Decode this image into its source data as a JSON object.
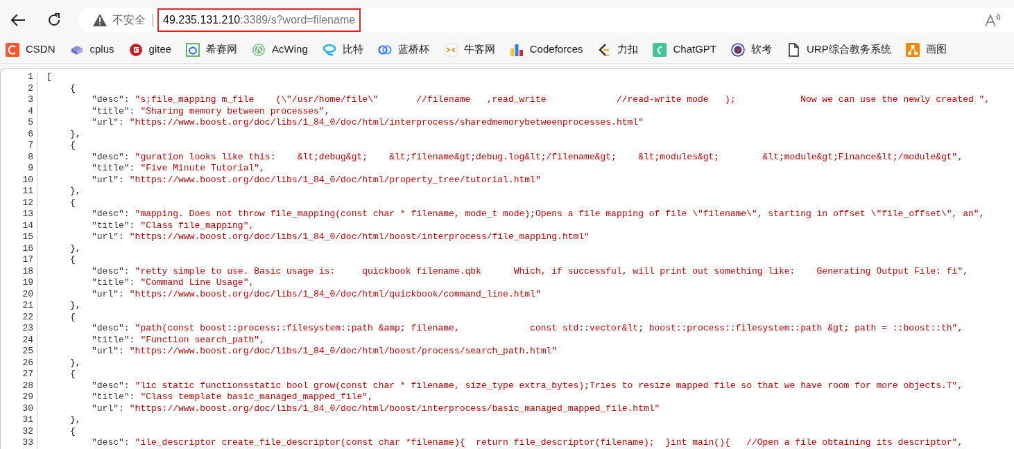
{
  "toolbar": {
    "security_label": "不安全",
    "url_host": "49.235.131.210",
    "url_rest": ":3389/s?word=filename",
    "url_highlighted": true
  },
  "bookmarks": [
    {
      "label": "CSDN"
    },
    {
      "label": "cplus"
    },
    {
      "label": "gitee"
    },
    {
      "label": "希赛网"
    },
    {
      "label": "AcWing"
    },
    {
      "label": "比特"
    },
    {
      "label": "蓝桥杯"
    },
    {
      "label": "牛客网"
    },
    {
      "label": "Codeforces"
    },
    {
      "label": "力扣"
    },
    {
      "label": "ChatGPT"
    },
    {
      "label": "软考"
    },
    {
      "label": "URP综合教务系统"
    },
    {
      "label": "画图"
    }
  ],
  "source_lines": [
    {
      "number": "1",
      "kind": "array",
      "text": "["
    },
    {
      "number": "2",
      "kind": "object",
      "text": "{"
    },
    {
      "number": "3",
      "kind": "field",
      "key": "\"desc\":",
      "value": "\"s;file_mapping m_file    (\\\"/usr/home/file\\\"       //filename   ,read_write             //read-write mode   );            Now we can use the newly created \","
    },
    {
      "number": "4",
      "kind": "field",
      "key": "\"title\":",
      "value": "\"Sharing memory between processes\","
    },
    {
      "number": "5",
      "kind": "field",
      "key": "\"url\":",
      "value": "\"https://www.boost.org/doc/libs/1_84_0/doc/html/interprocess/sharedmemorybetweenprocesses.html\""
    },
    {
      "number": "6",
      "kind": "object",
      "text": "},"
    },
    {
      "number": "7",
      "kind": "object",
      "text": "{"
    },
    {
      "number": "8",
      "kind": "field",
      "key": "\"desc\":",
      "value": "\"guration looks like this:    &lt;debug&gt;    &lt;filename&gt;debug.log&lt;/filename&gt;    &lt;modules&gt;        &lt;module&gt;Finance&lt;/module&gt\","
    },
    {
      "number": "9",
      "kind": "field",
      "key": "\"title\":",
      "value": "\"Five Minute Tutorial\","
    },
    {
      "number": "10",
      "kind": "field",
      "key": "\"url\":",
      "value": "\"https://www.boost.org/doc/libs/1_84_0/doc/html/property_tree/tutorial.html\""
    },
    {
      "number": "11",
      "kind": "object",
      "text": "},"
    },
    {
      "number": "12",
      "kind": "object",
      "text": "{"
    },
    {
      "number": "13",
      "kind": "field",
      "key": "\"desc\":",
      "value": "\"mapping. Does not throw file_mapping(const char * filename, mode_t mode);Opens a file mapping of file \\\"filename\\\", starting in offset \\\"file_offset\\\", an\","
    },
    {
      "number": "14",
      "kind": "field",
      "key": "\"title\":",
      "value": "\"Class file_mapping\","
    },
    {
      "number": "15",
      "kind": "field",
      "key": "\"url\":",
      "value": "\"https://www.boost.org/doc/libs/1_84_0/doc/html/boost/interprocess/file_mapping.html\""
    },
    {
      "number": "16",
      "kind": "object",
      "text": "},"
    },
    {
      "number": "17",
      "kind": "object",
      "text": "{"
    },
    {
      "number": "18",
      "kind": "field",
      "key": "\"desc\":",
      "value": "\"retty simple to use. Basic usage is:     quickbook filename.qbk      Which, if successful, will print out something like:    Generating Output File: fi\","
    },
    {
      "number": "19",
      "kind": "field",
      "key": "\"title\":",
      "value": "\"Command Line Usage\","
    },
    {
      "number": "20",
      "kind": "field",
      "key": "\"url\":",
      "value": "\"https://www.boost.org/doc/libs/1_84_0/doc/html/quickbook/command_line.html\""
    },
    {
      "number": "21",
      "kind": "object",
      "text": "},"
    },
    {
      "number": "22",
      "kind": "object",
      "text": "{"
    },
    {
      "number": "23",
      "kind": "field",
      "key": "\"desc\":",
      "value": "\"path(const boost::process::filesystem::path &amp; filename,             const std::vector&lt; boost::process::filesystem::path &gt; path = ::boost::th\","
    },
    {
      "number": "24",
      "kind": "field",
      "key": "\"title\":",
      "value": "\"Function search_path\","
    },
    {
      "number": "25",
      "kind": "field",
      "key": "\"url\":",
      "value": "\"https://www.boost.org/doc/libs/1_84_0/doc/html/boost/process/search_path.html\""
    },
    {
      "number": "26",
      "kind": "object",
      "text": "},"
    },
    {
      "number": "27",
      "kind": "object",
      "text": "{"
    },
    {
      "number": "28",
      "kind": "field",
      "key": "\"desc\":",
      "value": "\"lic static functionsstatic bool grow(const char * filename, size_type extra_bytes);Tries to resize mapped file so that we have room for more objects.T\","
    },
    {
      "number": "29",
      "kind": "field",
      "key": "\"title\":",
      "value": "\"Class template basic_managed_mapped_file\","
    },
    {
      "number": "30",
      "kind": "field",
      "key": "\"url\":",
      "value": "\"https://www.boost.org/doc/libs/1_84_0/doc/html/boost/interprocess/basic_managed_mapped_file.html\""
    },
    {
      "number": "31",
      "kind": "object",
      "text": "},"
    },
    {
      "number": "32",
      "kind": "object",
      "text": "{"
    },
    {
      "number": "33",
      "kind": "field",
      "key": "\"desc\":",
      "value": "\"ile_descriptor create_file_descriptor(const char *filename){  return file_descriptor(filename);  }int main(){   //Open a file obtaining its descriptor\","
    }
  ]
}
